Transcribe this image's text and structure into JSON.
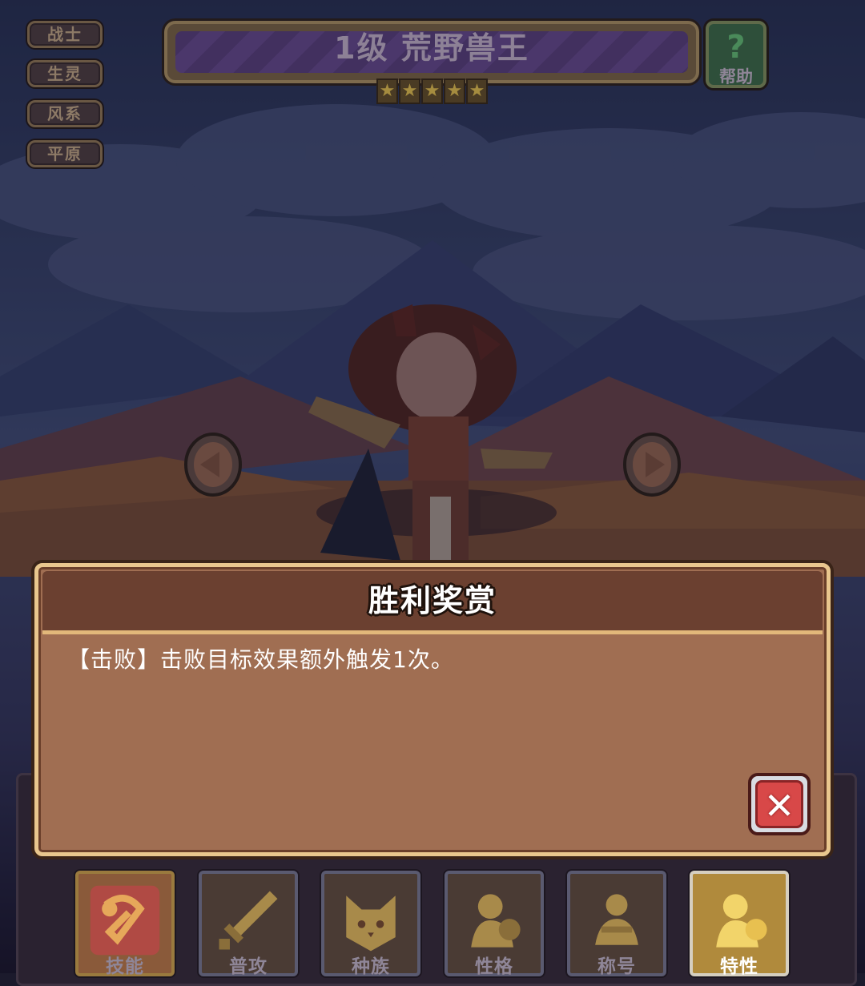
{
  "tags": [
    "战士",
    "生灵",
    "风系",
    "平原"
  ],
  "banner": {
    "title": "1级 荒野兽王",
    "star_count": 5,
    "star_glyph": "★"
  },
  "help": {
    "icon": "question-mark-icon",
    "glyph": "?",
    "label": "帮助"
  },
  "navigation": {
    "prev_icon": "arrow-left-icon",
    "next_icon": "arrow-right-icon"
  },
  "modal": {
    "title": "胜利奖赏",
    "description": "【击败】击败目标效果额外触发1次。",
    "close_glyph": "✕"
  },
  "tabs": [
    {
      "label": "技能",
      "icon": "skill-icon"
    },
    {
      "label": "普攻",
      "icon": "sword-icon"
    },
    {
      "label": "种族",
      "icon": "cat-face-icon"
    },
    {
      "label": "性格",
      "icon": "character-icon"
    },
    {
      "label": "称号",
      "icon": "title-icon"
    },
    {
      "label": "特性",
      "icon": "trait-icon",
      "active": true
    }
  ],
  "colors": {
    "modal_bg": "#a06e52",
    "modal_header": "#6b4030",
    "accent_gold": "#e9c78e",
    "close_red": "#d84848"
  }
}
